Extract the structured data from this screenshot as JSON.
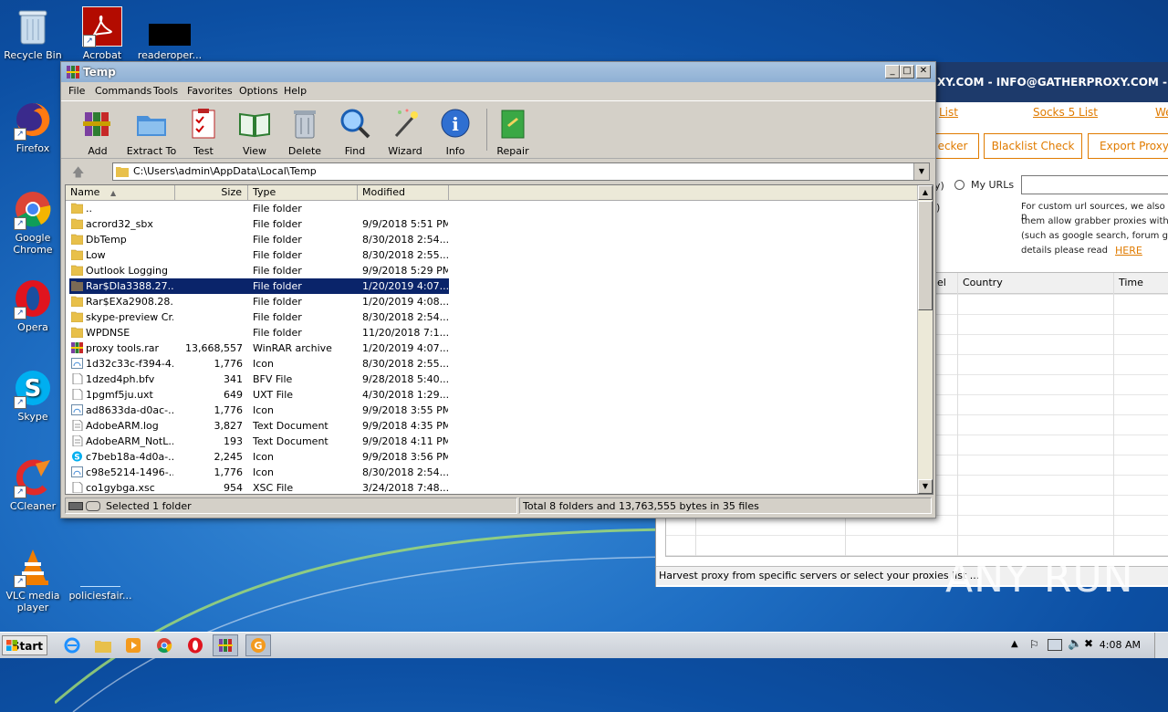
{
  "desktop": {
    "icons": [
      {
        "label": "Recycle Bin"
      },
      {
        "label": "Acrobat"
      },
      {
        "label": "readeroper..."
      },
      {
        "label": "Firefox"
      },
      {
        "label": "Google Chrome"
      },
      {
        "label": "Opera"
      },
      {
        "label": "Skype"
      },
      {
        "label": "CCleaner"
      },
      {
        "label": "VLC media player"
      },
      {
        "label": "policiesfair..."
      }
    ]
  },
  "bgapp": {
    "title": "XY.COM - INFO@GATHERPROXY.COM - [PREM",
    "link_list": "List",
    "link_socks": "Socks 5 List",
    "link_we": "We",
    "btn_checker": "ecker",
    "btn_blacklist": "Blacklist Check",
    "btn_export": "Export Proxy",
    "radio_paren": "y)",
    "radio_myurls": "My URLs",
    "paren2": ")",
    "desc_line1": "For custom url sources, we also p",
    "desc_line2": "them allow grabber proxies with",
    "desc_line3": "(such as google search, forum g",
    "desc_line4": "details please read",
    "desc_here": "HERE",
    "col_el": "el",
    "col_country": "Country",
    "col_time": "Time",
    "status": "Harvest proxy from specific servers or select your proxies list ..."
  },
  "winrar": {
    "title": "Temp",
    "menu": [
      "File",
      "Commands",
      "Tools",
      "Favorites",
      "Options",
      "Help"
    ],
    "toolbar": [
      "Add",
      "Extract To",
      "Test",
      "View",
      "Delete",
      "Find",
      "Wizard",
      "Info",
      "Repair"
    ],
    "path": "C:\\Users\\admin\\AppData\\Local\\Temp",
    "columns": [
      "Name",
      "Size",
      "Type",
      "Modified"
    ],
    "rows": [
      {
        "name": "..",
        "size": "",
        "type": "File folder",
        "modified": "",
        "icon": "folder"
      },
      {
        "name": "acrord32_sbx",
        "size": "",
        "type": "File folder",
        "modified": "9/9/2018 5:51 PM",
        "icon": "folder"
      },
      {
        "name": "DbTemp",
        "size": "",
        "type": "File folder",
        "modified": "8/30/2018 2:54...",
        "icon": "folder"
      },
      {
        "name": "Low",
        "size": "",
        "type": "File folder",
        "modified": "8/30/2018 2:55...",
        "icon": "folder"
      },
      {
        "name": "Outlook Logging",
        "size": "",
        "type": "File folder",
        "modified": "9/9/2018 5:29 PM",
        "icon": "folder"
      },
      {
        "name": "Rar$DIa3388.27...",
        "size": "",
        "type": "File folder",
        "modified": "1/20/2019 4:07...",
        "icon": "folder-dark",
        "selected": true
      },
      {
        "name": "Rar$EXa2908.28...",
        "size": "",
        "type": "File folder",
        "modified": "1/20/2019 4:08...",
        "icon": "folder"
      },
      {
        "name": "skype-preview Cr...",
        "size": "",
        "type": "File folder",
        "modified": "8/30/2018 2:54...",
        "icon": "folder"
      },
      {
        "name": "WPDNSE",
        "size": "",
        "type": "File folder",
        "modified": "11/20/2018 7:1...",
        "icon": "folder"
      },
      {
        "name": "proxy tools.rar",
        "size": "13,668,557",
        "type": "WinRAR archive",
        "modified": "1/20/2019 4:07...",
        "icon": "rar"
      },
      {
        "name": "1d32c33c-f394-4...",
        "size": "1,776",
        "type": "Icon",
        "modified": "8/30/2018 2:55...",
        "icon": "ico"
      },
      {
        "name": "1dzed4ph.bfv",
        "size": "341",
        "type": "BFV File",
        "modified": "9/28/2018 5:40...",
        "icon": "file"
      },
      {
        "name": "1pgmf5ju.uxt",
        "size": "649",
        "type": "UXT File",
        "modified": "4/30/2018 1:29...",
        "icon": "file"
      },
      {
        "name": "ad8633da-d0ac-...",
        "size": "1,776",
        "type": "Icon",
        "modified": "9/9/2018 3:55 PM",
        "icon": "ico"
      },
      {
        "name": "AdobeARM.log",
        "size": "3,827",
        "type": "Text Document",
        "modified": "9/9/2018 4:35 PM",
        "icon": "txt"
      },
      {
        "name": "AdobeARM_NotL...",
        "size": "193",
        "type": "Text Document",
        "modified": "9/9/2018 4:11 PM",
        "icon": "txt"
      },
      {
        "name": "c7beb18a-4d0a-...",
        "size": "2,245",
        "type": "Icon",
        "modified": "9/9/2018 3:56 PM",
        "icon": "skype"
      },
      {
        "name": "c98e5214-1496-...",
        "size": "1,776",
        "type": "Icon",
        "modified": "8/30/2018 2:54...",
        "icon": "ico"
      },
      {
        "name": "co1gybga.xsc",
        "size": "954",
        "type": "XSC File",
        "modified": "3/24/2018 7:48...",
        "icon": "file"
      }
    ],
    "status_left": "Selected 1 folder",
    "status_right": "Total 8 folders and 13,763,555 bytes in 35 files"
  },
  "taskbar": {
    "start_label": "Start",
    "clock": "4:08 AM"
  },
  "watermark": "ANY RUN"
}
